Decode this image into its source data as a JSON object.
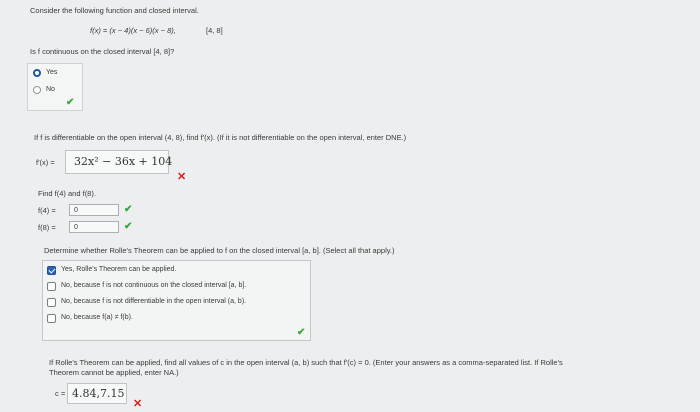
{
  "intro": "Consider the following function and closed interval.",
  "function_def": "f(x) = (x − 4)(x − 6)(x − 8),",
  "interval": "[4, 8]",
  "icons": {
    "check": "✔",
    "cross": "✕"
  },
  "q1": {
    "question": "Is f continuous on the closed interval [4, 8]?",
    "options": [
      "Yes",
      "No"
    ],
    "selected": "Yes"
  },
  "q2": {
    "question": "If f is differentiable on the open interval (4, 8), find f′(x). (If it is not differentiable on the open interval, enter DNE.)",
    "label": "f′(x) =",
    "answer": "32x² − 36x + 104"
  },
  "q3": {
    "prompt": "Find f(4) and f(8).",
    "f4_label": "f(4) =",
    "f4_value": "0",
    "f8_label": "f(8) =",
    "f8_value": "0"
  },
  "q4": {
    "question": "Determine whether Rolle's Theorem can be applied to f on the closed interval [a, b]. (Select all that apply.)",
    "options": [
      "Yes, Rolle's Theorem can be applied.",
      "No, because f is not continuous on the closed interval [a, b].",
      "No, because f is not differentiable in the open interval (a, b).",
      "No, because f(a) ≠ f(b)."
    ],
    "checked": [
      true,
      false,
      false,
      false
    ]
  },
  "q5": {
    "question_line1": "If Rolle's Theorem can be applied, find all values of c in the open interval (a, b) such that f′(c) = 0. (Enter your answers as a comma-separated list. If Rolle's",
    "question_line2": "Theorem cannot be applied, enter NA.)",
    "label": "c =",
    "answer": "4.84,7.15"
  }
}
